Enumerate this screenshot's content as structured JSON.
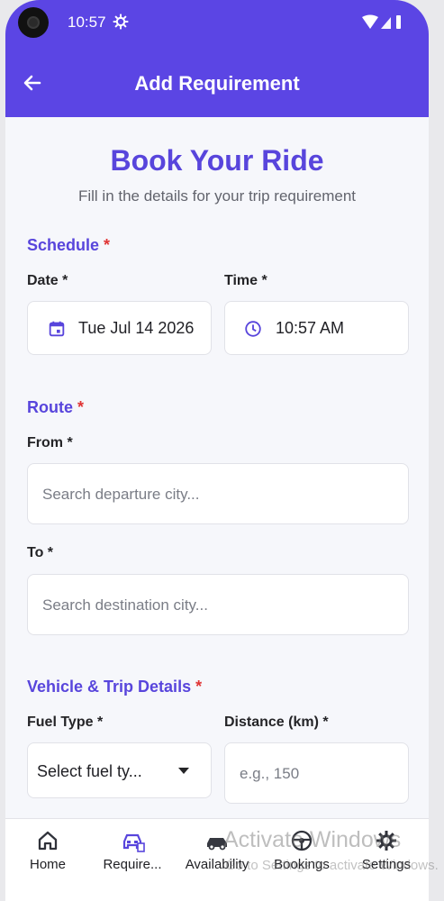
{
  "status_bar": {
    "time": "10:57"
  },
  "app_bar": {
    "title": "Add Requirement"
  },
  "hero": {
    "title": "Book Your Ride",
    "subtitle": "Fill in the details for your trip requirement"
  },
  "schedule": {
    "section_title": "Schedule",
    "required_mark": "*",
    "date_label": "Date *",
    "date_value": "Tue Jul 14 2026",
    "time_label": "Time *",
    "time_value": "10:57 AM"
  },
  "route": {
    "section_title": "Route",
    "required_mark": "*",
    "from_label": "From *",
    "from_placeholder": "Search departure city...",
    "to_label": "To *",
    "to_placeholder": "Search destination city..."
  },
  "vehicle_details": {
    "section_title": "Vehicle & Trip Details",
    "required_mark": "*",
    "fuel_type_label": "Fuel Type *",
    "fuel_type_value": "Select fuel ty...",
    "distance_label": "Distance (km) *",
    "distance_placeholder": "e.g., 150"
  },
  "bottom_nav": {
    "items": [
      {
        "label": "Home",
        "icon": "home-icon",
        "active": false
      },
      {
        "label": "Require...",
        "icon": "car-document-icon",
        "active": true
      },
      {
        "label": "Availability",
        "icon": "car-icon",
        "active": false
      },
      {
        "label": "Bookings",
        "icon": "steering-wheel-icon",
        "active": false
      },
      {
        "label": "Settings",
        "icon": "gear-icon",
        "active": false
      }
    ]
  },
  "watermark": {
    "line1": "Activate Windows",
    "line2": "Go to Settings to activate Windows."
  },
  "colors": {
    "primary": "#5b45e4",
    "accent": "#5845dc",
    "required": "#e03434",
    "background": "#f6f7fb"
  }
}
